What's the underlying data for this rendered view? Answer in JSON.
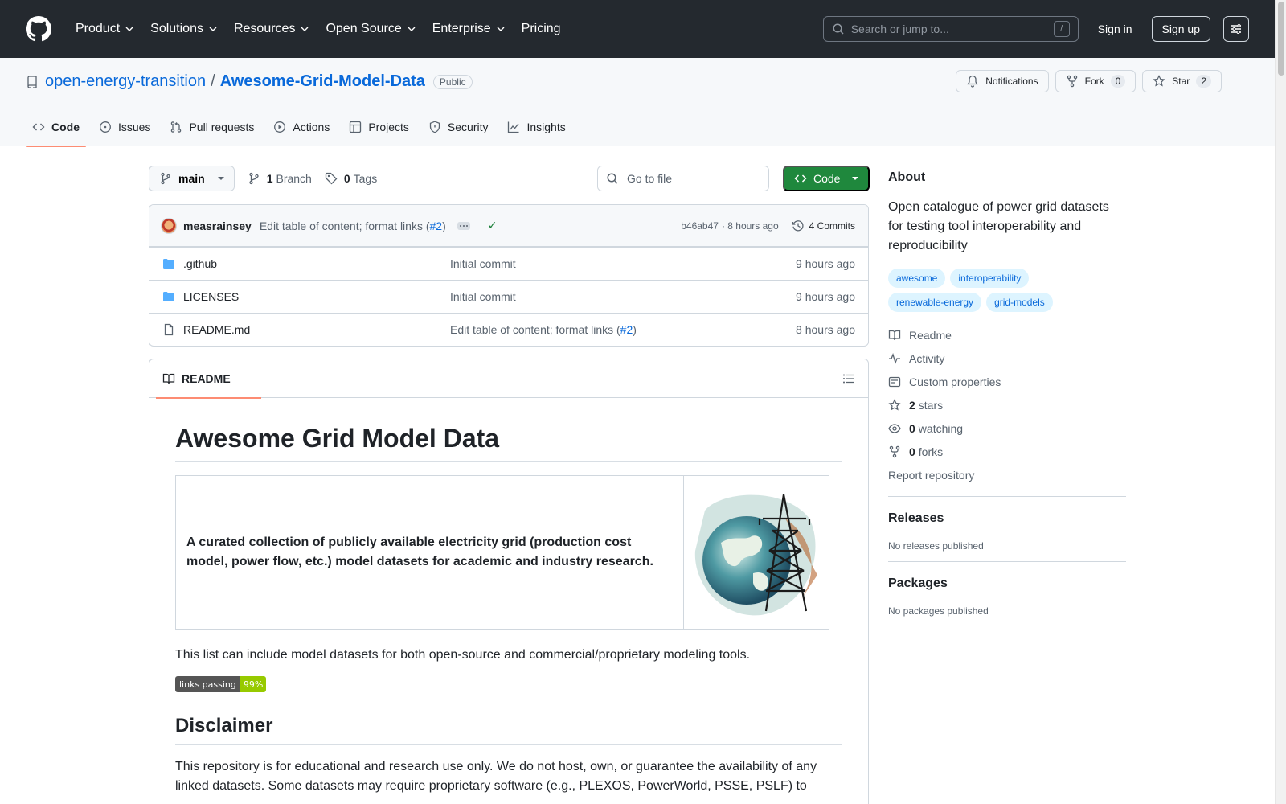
{
  "header": {
    "nav": [
      "Product",
      "Solutions",
      "Resources",
      "Open Source",
      "Enterprise",
      "Pricing"
    ],
    "search_placeholder": "Search or jump to...",
    "search_kbd": "/",
    "signin": "Sign in",
    "signup": "Sign up"
  },
  "repo": {
    "owner": "open-energy-transition",
    "separator": "/",
    "name": "Awesome-Grid-Model-Data",
    "visibility": "Public",
    "notifications": "Notifications",
    "fork_label": "Fork",
    "fork_count": "0",
    "star_label": "Star",
    "star_count": "2",
    "tabs": [
      "Code",
      "Issues",
      "Pull requests",
      "Actions",
      "Projects",
      "Security",
      "Insights"
    ]
  },
  "toolbar": {
    "branch": "main",
    "branch_count": "1",
    "branch_label": "Branch",
    "tag_count": "0",
    "tag_label": "Tags",
    "goto_placeholder": "Go to file",
    "code_button": "Code"
  },
  "commit": {
    "author": "measrainsey",
    "message_prefix": "Edit table of content; format links (",
    "message_link": "#2",
    "message_suffix": ")",
    "hash": "b46ab47",
    "time": "· 8 hours ago",
    "commits": "4 Commits"
  },
  "files": [
    {
      "name": ".github",
      "type": "folder",
      "message": "Initial commit",
      "time": "9 hours ago"
    },
    {
      "name": "LICENSES",
      "type": "folder",
      "message": "Initial commit",
      "time": "9 hours ago"
    },
    {
      "name": "README.md",
      "type": "file",
      "message_prefix": "Edit table of content; format links (",
      "message_link": "#2",
      "message_suffix": ")",
      "time": "8 hours ago"
    }
  ],
  "readme": {
    "tab": "README",
    "h1": "Awesome Grid Model Data",
    "intro": "A curated collection of publicly available electricity grid (production cost model, power flow, etc.) model datasets for academic and industry research.",
    "p1": "This list can include model datasets for both open-source and commercial/proprietary modeling tools.",
    "badge_left": "links passing",
    "badge_right": "99%",
    "h2": "Disclaimer",
    "p2": "This repository is for educational and research use only. We do not host, own, or guarantee the availability of any linked datasets. Some datasets may require proprietary software (e.g., PLEXOS, PowerWorld, PSSE, PSLF) to"
  },
  "sidebar": {
    "about_title": "About",
    "description": "Open catalogue of power grid datasets for testing tool interoperability and reproducibility",
    "topics": [
      "awesome",
      "interoperability",
      "renewable-energy",
      "grid-models"
    ],
    "readme": "Readme",
    "activity": "Activity",
    "custom_properties": "Custom properties",
    "stars_count": "2",
    "stars_label": "stars",
    "watching_count": "0",
    "watching_label": "watching",
    "forks_count": "0",
    "forks_label": "forks",
    "report": "Report repository",
    "releases_title": "Releases",
    "releases_empty": "No releases published",
    "packages_title": "Packages",
    "packages_empty": "No packages published"
  },
  "colors": {
    "header_bg": "#24292f",
    "link": "#0969da",
    "primary_button": "#1f883d",
    "active_tab_underline": "#fd8c73"
  }
}
